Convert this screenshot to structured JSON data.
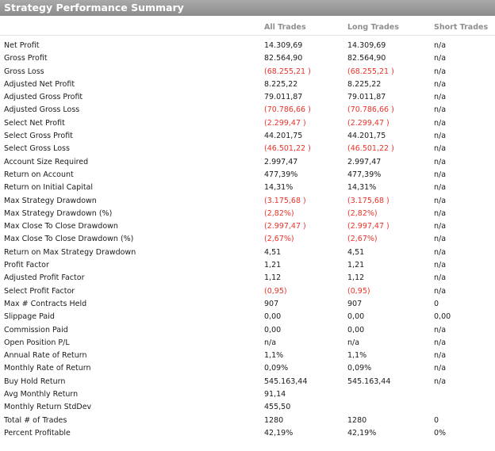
{
  "title": "Strategy Performance Summary",
  "columns": [
    "All Trades",
    "Long Trades",
    "Short Trades"
  ],
  "colors": {
    "negative": "#e8332a",
    "title_bar": "#999999",
    "header_text": "#8f8f8f"
  },
  "rows": [
    {
      "label": "Net Profit",
      "all": "14.309,69",
      "long": "14.309,69",
      "short": "n/a",
      "neg": false
    },
    {
      "label": "Gross Profit",
      "all": "82.564,90",
      "long": "82.564,90",
      "short": "n/a",
      "neg": false
    },
    {
      "label": "Gross Loss",
      "all": "(68.255,21 )",
      "long": "(68.255,21 )",
      "short": "n/a",
      "neg": true
    },
    {
      "label": "Adjusted Net Profit",
      "all": "8.225,22",
      "long": "8.225,22",
      "short": "n/a",
      "neg": false
    },
    {
      "label": "Adjusted Gross Profit",
      "all": "79.011,87",
      "long": "79.011,87",
      "short": "n/a",
      "neg": false
    },
    {
      "label": "Adjusted Gross Loss",
      "all": "(70.786,66 )",
      "long": "(70.786,66 )",
      "short": "n/a",
      "neg": true
    },
    {
      "label": "Select Net Profit",
      "all": "(2.299,47 )",
      "long": "(2.299,47 )",
      "short": "n/a",
      "neg": true
    },
    {
      "label": "Select Gross Profit",
      "all": "44.201,75",
      "long": "44.201,75",
      "short": "n/a",
      "neg": false
    },
    {
      "label": "Select Gross Loss",
      "all": "(46.501,22 )",
      "long": "(46.501,22 )",
      "short": "n/a",
      "neg": true
    },
    {
      "label": "Account Size Required",
      "all": "2.997,47",
      "long": "2.997,47",
      "short": "n/a",
      "neg": false
    },
    {
      "label": "Return on Account",
      "all": "477,39%",
      "long": "477,39%",
      "short": "n/a",
      "neg": false
    },
    {
      "label": "Return on Initial Capital",
      "all": "14,31%",
      "long": "14,31%",
      "short": "n/a",
      "neg": false
    },
    {
      "label": "Max Strategy Drawdown",
      "all": "(3.175,68 )",
      "long": "(3.175,68 )",
      "short": "n/a",
      "neg": true
    },
    {
      "label": "Max Strategy Drawdown (%)",
      "all": "(2,82%)",
      "long": "(2,82%)",
      "short": "n/a",
      "neg": true
    },
    {
      "label": "Max Close To Close Drawdown",
      "all": "(2.997,47 )",
      "long": "(2.997,47 )",
      "short": "n/a",
      "neg": true
    },
    {
      "label": "Max Close To Close Drawdown (%)",
      "all": "(2,67%)",
      "long": "(2,67%)",
      "short": "n/a",
      "neg": true
    },
    {
      "label": "Return on Max Strategy Drawdown",
      "all": "4,51",
      "long": "4,51",
      "short": "n/a",
      "neg": false
    },
    {
      "label": "Profit Factor",
      "all": "1,21",
      "long": "1,21",
      "short": "n/a",
      "neg": false
    },
    {
      "label": "Adjusted Profit Factor",
      "all": "1,12",
      "long": "1,12",
      "short": "n/a",
      "neg": false
    },
    {
      "label": "Select Profit Factor",
      "all": "(0,95)",
      "long": "(0,95)",
      "short": "n/a",
      "neg": true
    },
    {
      "label": "Max # Contracts Held",
      "all": "907",
      "long": "907",
      "short": "0",
      "neg": false
    },
    {
      "label": "Slippage Paid",
      "all": "0,00",
      "long": "0,00",
      "short": "0,00",
      "neg": false
    },
    {
      "label": "Commission Paid",
      "all": "0,00",
      "long": "0,00",
      "short": "n/a",
      "neg": false
    },
    {
      "label": "Open Position P/L",
      "all": "n/a",
      "long": "n/a",
      "short": "n/a",
      "neg": false
    },
    {
      "label": "Annual Rate of Return",
      "all": "1,1%",
      "long": "1,1%",
      "short": "n/a",
      "neg": false
    },
    {
      "label": "Monthly Rate of Return",
      "all": "0,09%",
      "long": "0,09%",
      "short": "n/a",
      "neg": false
    },
    {
      "label": "Buy  Hold Return",
      "all": "545.163,44",
      "long": "545.163,44",
      "short": "n/a",
      "neg": false
    },
    {
      "label": "Avg Monthly Return",
      "all": "91,14",
      "long": "",
      "short": "",
      "neg": false
    },
    {
      "label": "Monthly Return StdDev",
      "all": "455,50",
      "long": "",
      "short": "",
      "neg": false
    },
    {
      "label": "Total # of Trades",
      "all": "1280",
      "long": "1280",
      "short": "0",
      "neg": false
    },
    {
      "label": "Percent Profitable",
      "all": "42,19%",
      "long": "42,19%",
      "short": "0%",
      "neg": false
    }
  ]
}
